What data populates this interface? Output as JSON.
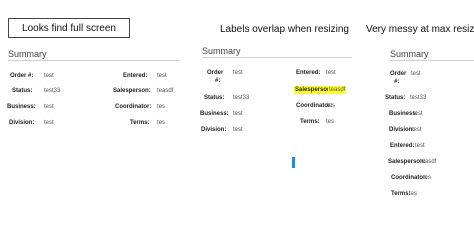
{
  "captions": {
    "full": "Looks find full screen",
    "resize": "Labels overlap when resizing",
    "max": "Very messy at max resize"
  },
  "summary_title": "Summary",
  "fields": {
    "order": {
      "label": "Order #:",
      "value": "test"
    },
    "status": {
      "label": "Status:",
      "value": "test33"
    },
    "business": {
      "label": "Business:",
      "value": "test"
    },
    "division": {
      "label": "Division:",
      "value": "test"
    },
    "entered": {
      "label": "Entered:",
      "value": "test"
    },
    "salesperson": {
      "label": "Salesperson:",
      "value": "teasdf"
    },
    "coordinator": {
      "label": "Coordinator:",
      "value": "tes"
    },
    "terms": {
      "label": "Terms:",
      "value": "tes"
    }
  },
  "panel3": {
    "order_label_line1": "Order",
    "order_label_line2": "#:"
  },
  "colors": {
    "highlight": "#ffff33",
    "accent": "#2e86de"
  }
}
